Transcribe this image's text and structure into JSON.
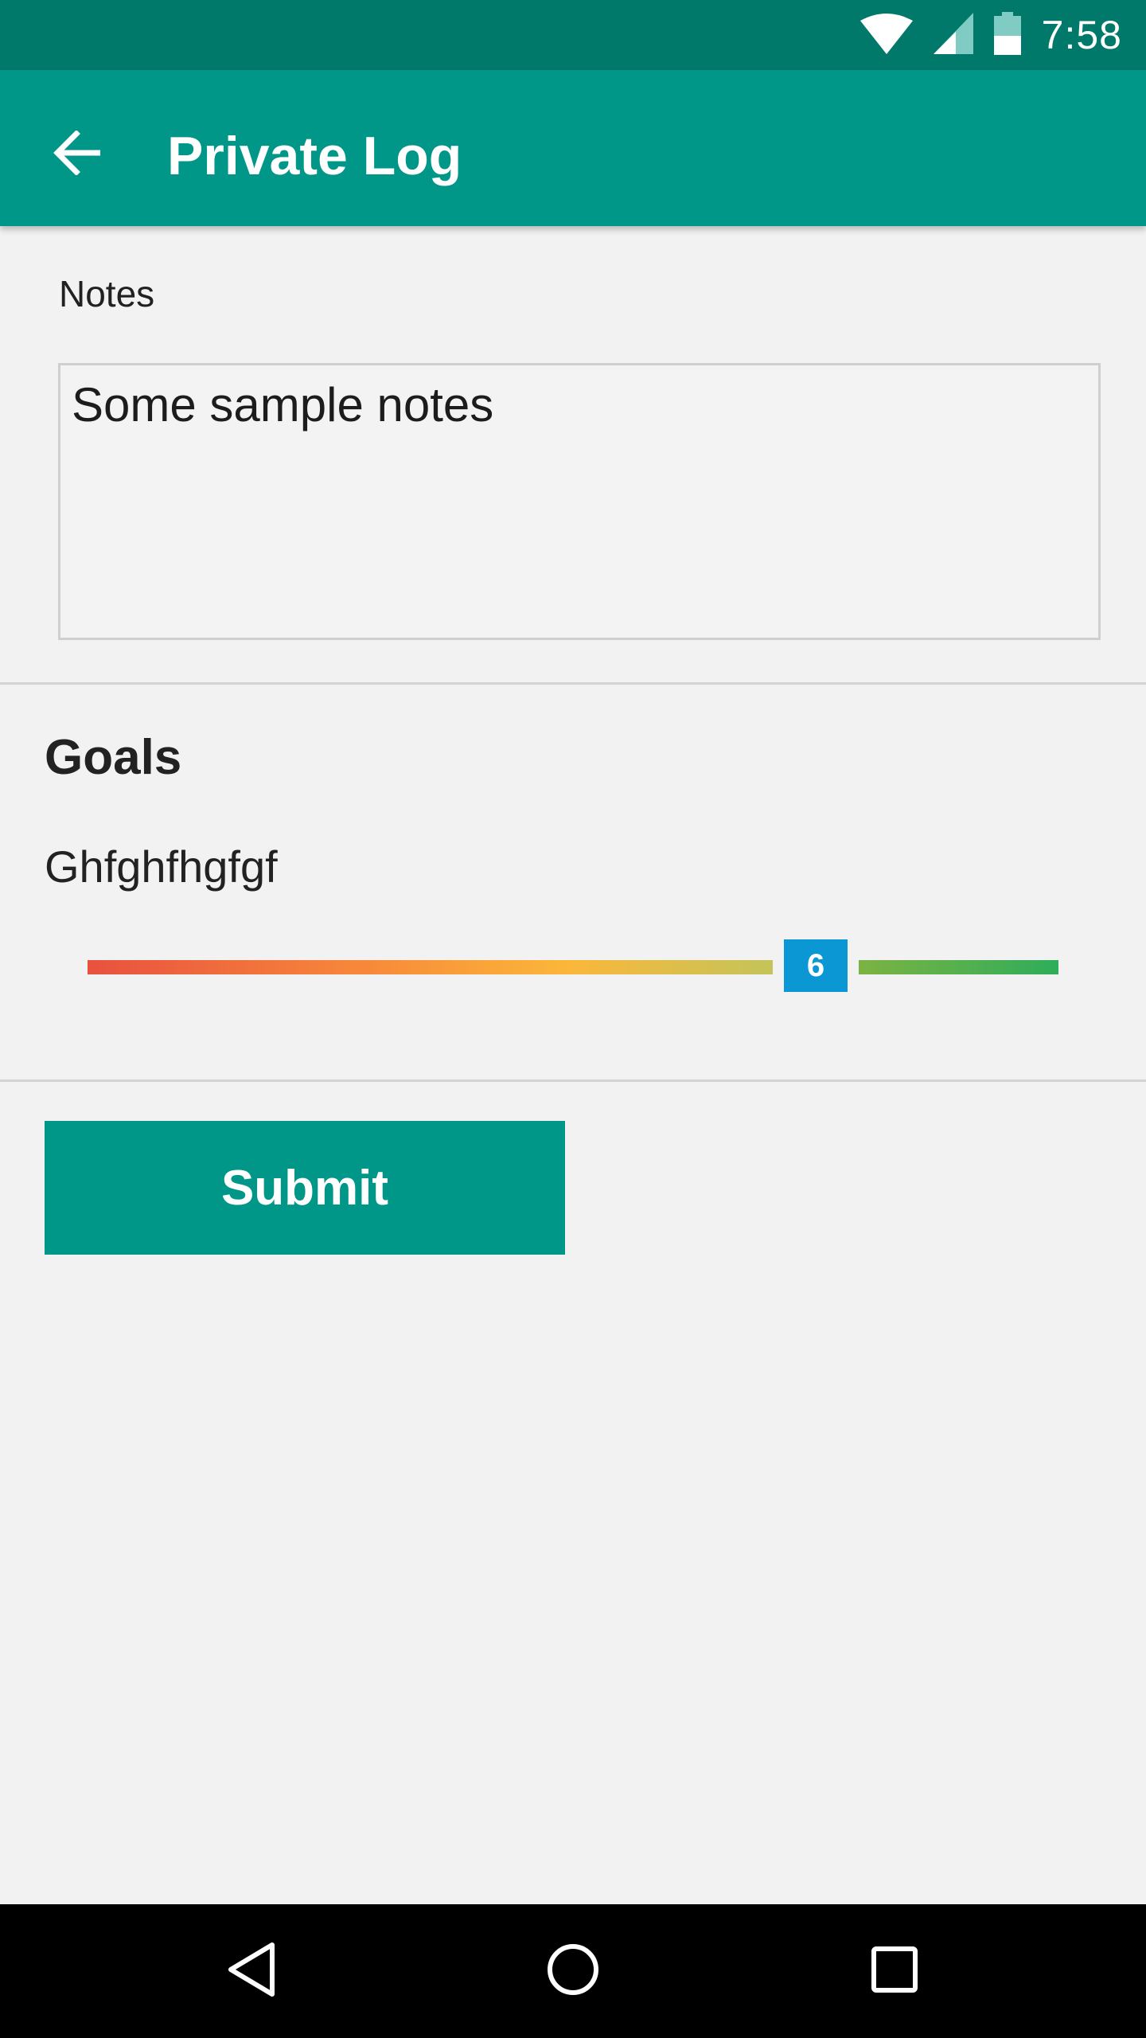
{
  "status_bar": {
    "time": "7:58",
    "icons": [
      "wifi-icon",
      "cell-signal-icon",
      "battery-icon"
    ]
  },
  "app_bar": {
    "back_icon": "arrow-back-icon",
    "title": "Private Log"
  },
  "notes": {
    "label": "Notes",
    "value": "Some sample notes"
  },
  "goals": {
    "title": "Goals",
    "items": [
      {
        "name": "Ghfghfhgfgf",
        "rating": 6,
        "rating_label": "6",
        "min": 0,
        "max": 8
      }
    ]
  },
  "submit": {
    "label": "Submit"
  },
  "nav_bar": {
    "icons": [
      "nav-back-icon",
      "nav-home-icon",
      "nav-recents-icon"
    ]
  },
  "colors": {
    "primary": "#009688",
    "primary_dark": "#00796b",
    "slider_thumb": "#0b97d3"
  }
}
